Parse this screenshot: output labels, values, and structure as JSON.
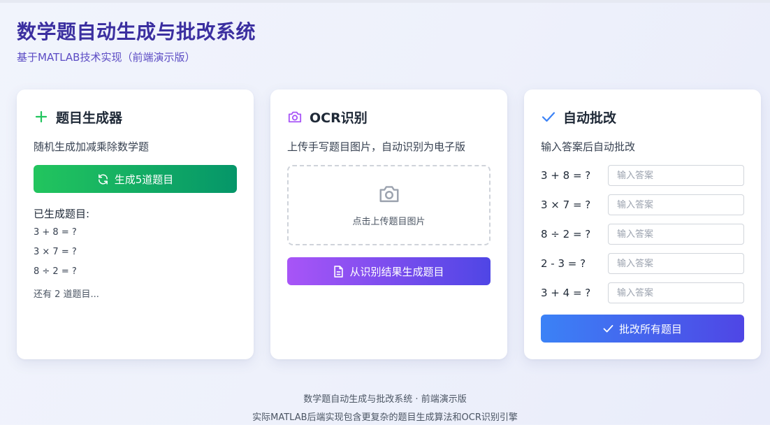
{
  "header": {
    "title": "数学题自动生成与批改系统",
    "subtitle": "基于MATLAB技术实现（前端演示版）"
  },
  "generator": {
    "icon": "plus-icon",
    "title": "题目生成器",
    "description": "随机生成加减乘除数学题",
    "button_icon": "refresh-icon",
    "button_label": "生成5道题目",
    "generated_label": "已生成题目:",
    "questions": [
      "3 + 8 = ?",
      "3 × 7 = ?",
      "8 ÷ 2 = ?"
    ],
    "more_text": "还有 2 道题目..."
  },
  "ocr": {
    "icon": "camera-icon",
    "title": "OCR识别",
    "description": "上传手写题目图片，自动识别为电子版",
    "upload_icon": "camera-icon",
    "upload_text": "点击上传题目图片",
    "button_icon": "document-icon",
    "button_label": "从识别结果生成题目"
  },
  "grading": {
    "icon": "check-icon",
    "title": "自动批改",
    "description": "输入答案后自动批改",
    "questions": [
      {
        "text": "3 + 8 = ?",
        "placeholder": "输入答案"
      },
      {
        "text": "3 × 7 = ?",
        "placeholder": "输入答案"
      },
      {
        "text": "8 ÷ 2 = ?",
        "placeholder": "输入答案"
      },
      {
        "text": "2 - 3 = ?",
        "placeholder": "输入答案"
      },
      {
        "text": "3 + 4 = ?",
        "placeholder": "输入答案"
      }
    ],
    "button_icon": "check-icon",
    "button_label": "批改所有题目"
  },
  "footer": {
    "line1": "数学题自动生成与批改系统 · 前端演示版",
    "line2": "实际MATLAB后端实现包含更复杂的题目生成算法和OCR识别引擎"
  },
  "colors": {
    "title": "#3b2fa0",
    "green_button": "#22c55e",
    "purple_button": "#a855f7",
    "blue_button": "#3b82f6"
  }
}
